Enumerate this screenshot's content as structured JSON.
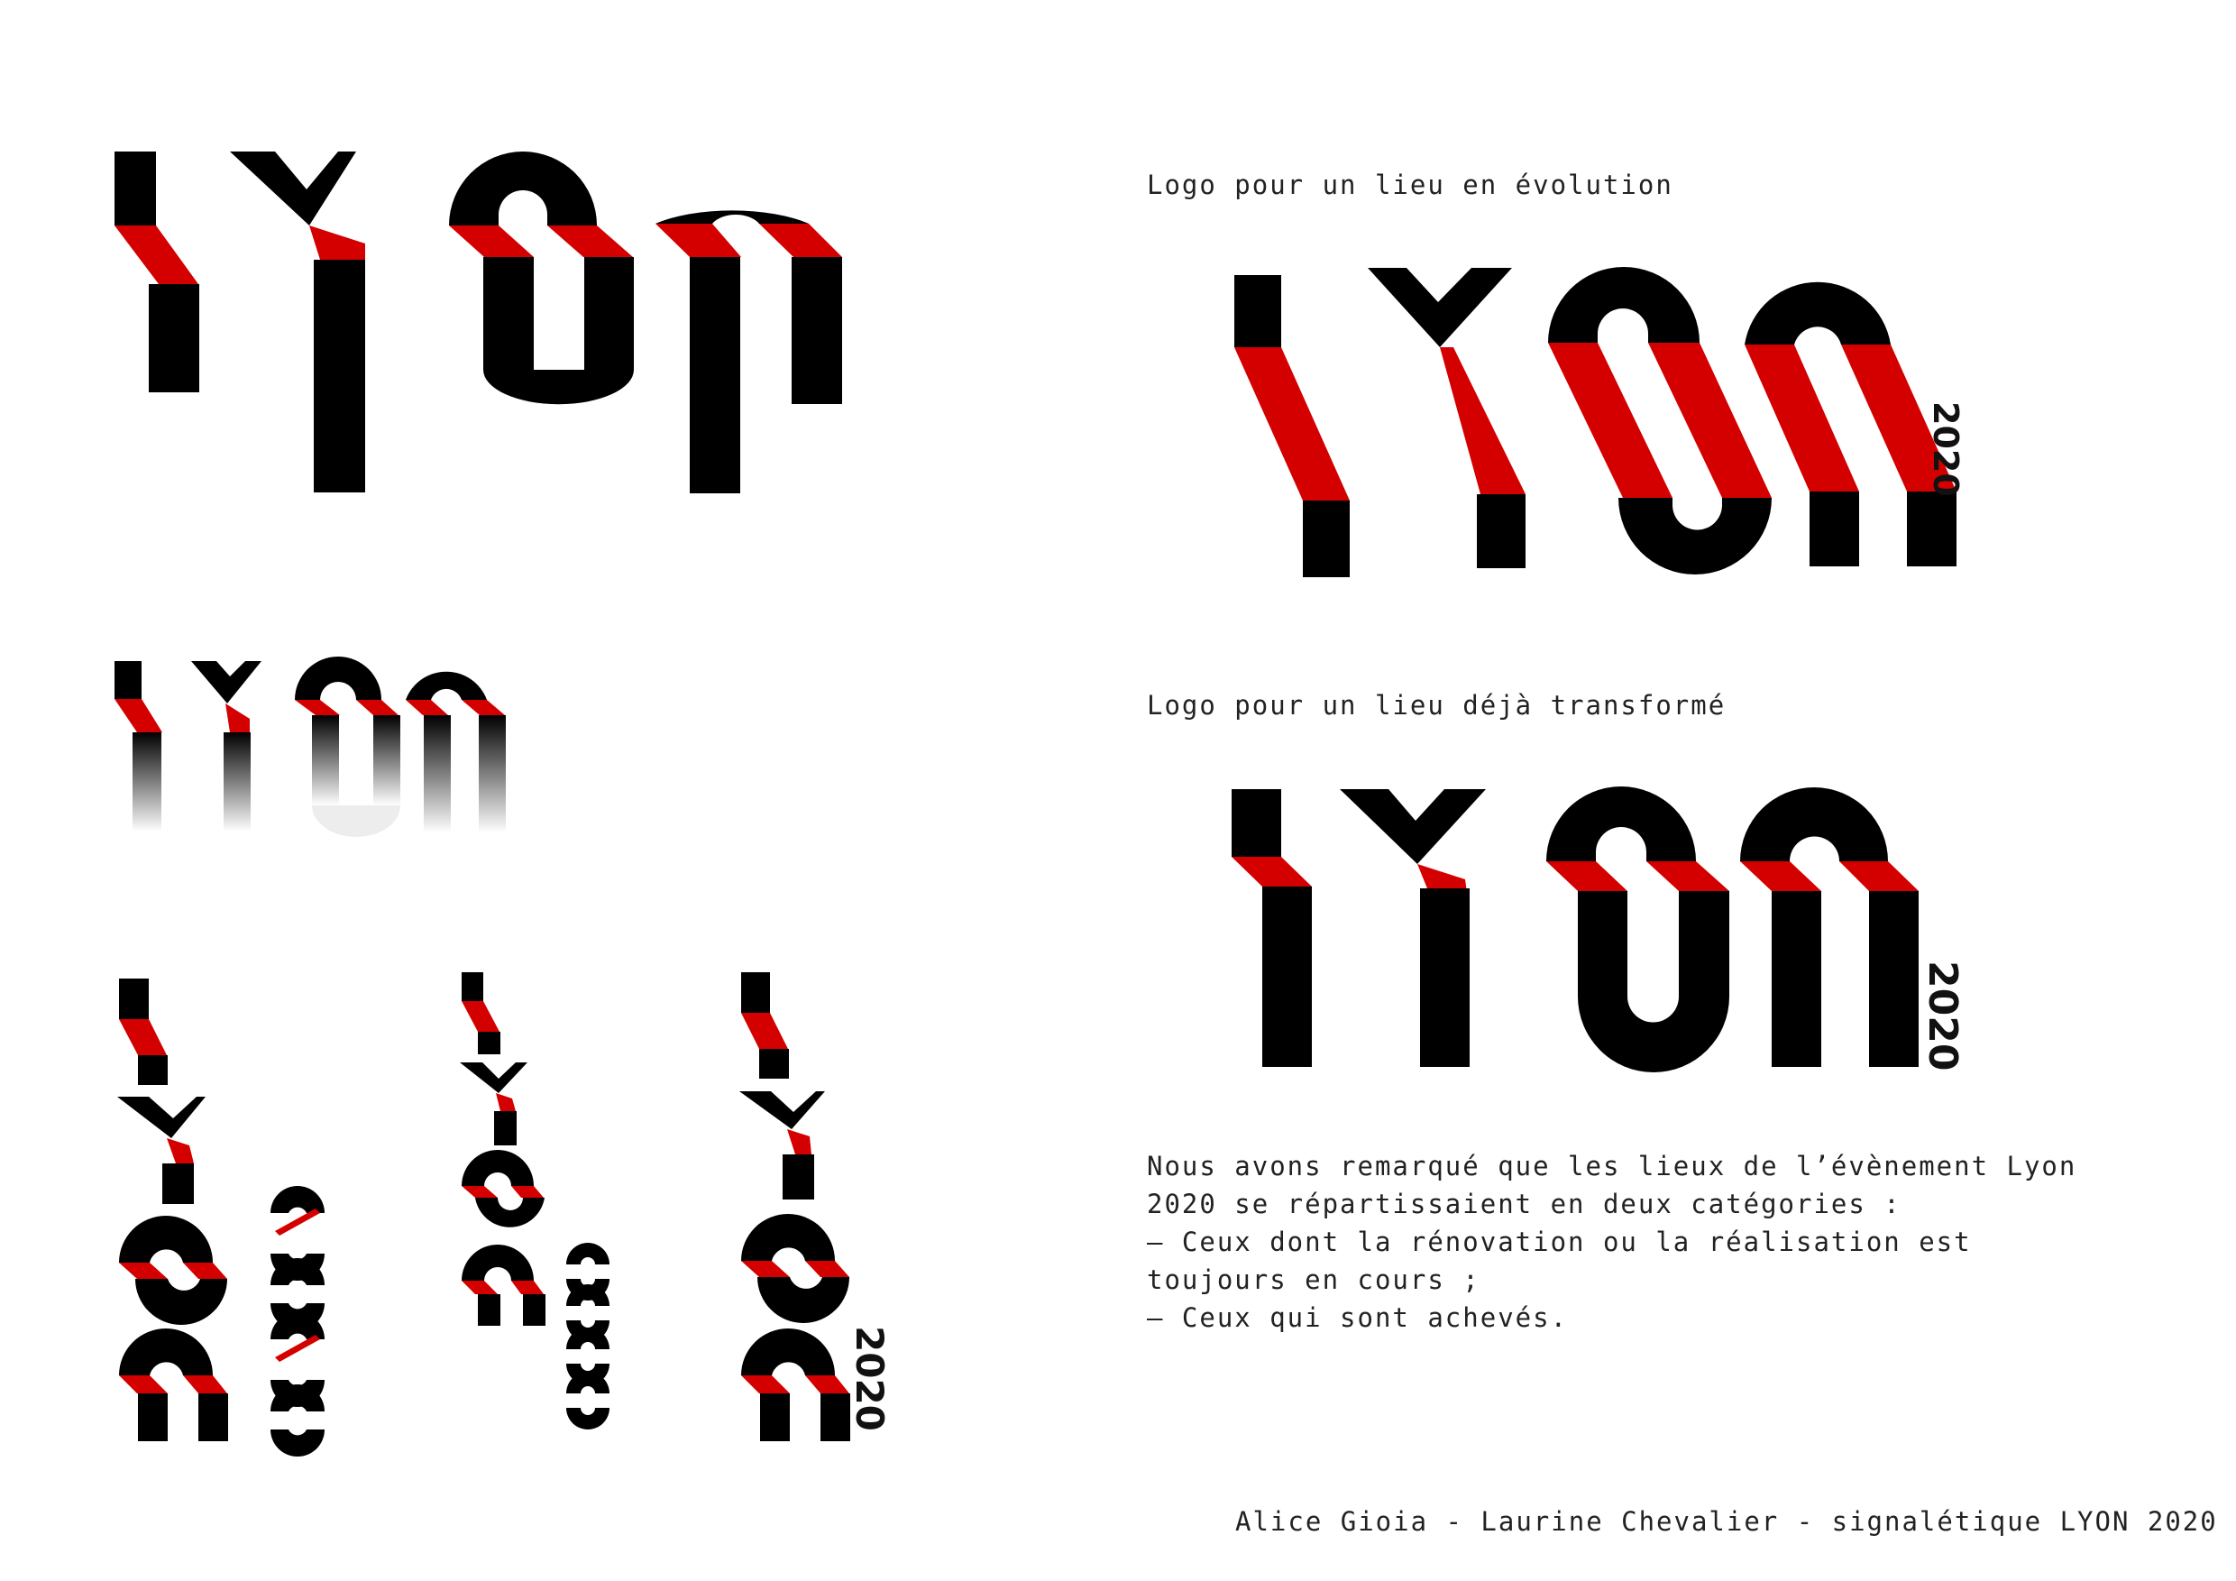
{
  "brand": {
    "red": "#d40000",
    "black": "#000000"
  },
  "captions": {
    "evolving": "Logo pour un lieu en évolution",
    "transformed": "Logo pour un lieu déjà transformé"
  },
  "year_label": "2020",
  "description_lines": [
    "Nous avons remarqué que les lieux de l’évènement Lyon",
    "2020 se répartissaient en deux catégories :",
    "— Ceux dont la rénovation ou la réalisation est",
    "toujours en cours ;",
    "— Ceux qui sont achevés."
  ],
  "credits": "Alice Gioia - Laurine Chevalier - signalétique LYON 2020"
}
